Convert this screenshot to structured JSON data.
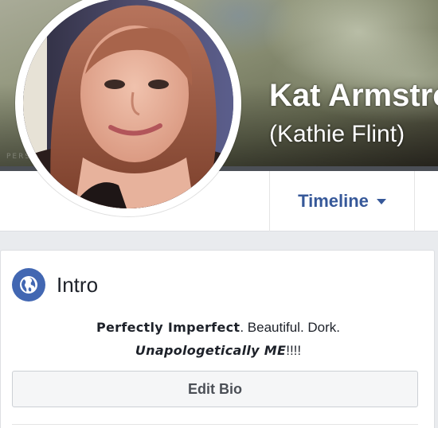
{
  "profile": {
    "name": "Kat Armstrong",
    "alternate_name": "(Kathie Flint)",
    "cover_watermark": "PERSON"
  },
  "nav": {
    "timeline_label": "Timeline",
    "timeline_icon": "caret-down-icon"
  },
  "intro": {
    "title": "Intro",
    "icon": "globe-icon",
    "bio_line1_bold": "Perfectly Imperfect",
    "bio_line1_rest": ". Beautiful. Dork.",
    "bio_line2_bold": "Unapologetically ME",
    "bio_line2_rest": "!!!!",
    "edit_bio_label": "Edit Bio"
  },
  "colors": {
    "link_blue": "#365899",
    "icon_blue": "#4267b2",
    "page_bg": "#e9ebee"
  }
}
